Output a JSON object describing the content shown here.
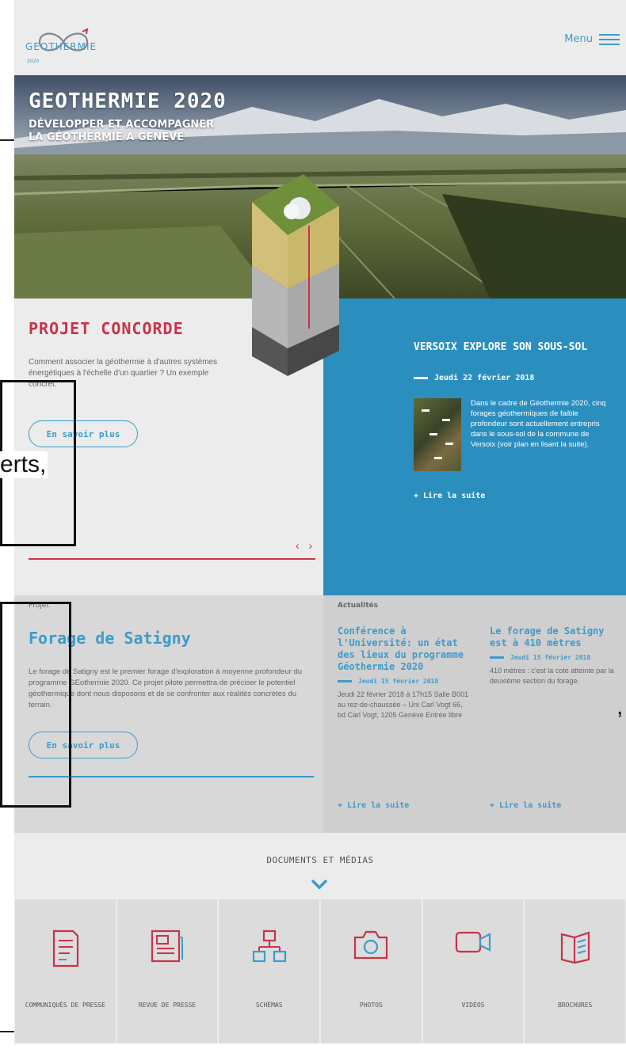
{
  "overlay": {
    "fragments": [
      "erts,",
      ","
    ]
  },
  "header": {
    "logo_name": "GEOTHERMIE",
    "logo_sub": "2020",
    "menu_label": "Menu"
  },
  "hero": {
    "title": "GEOTHERMIE 2020",
    "subtitle_line1": "DÉVELOPPER ET ACCOMPAGNER",
    "subtitle_line2": "LA GÉOTHERMIE À GENÈVE"
  },
  "concorde": {
    "title": "PROJET CONCORDE",
    "text": "Comment associer la géothermie à d'autres systèmes énergétiques à l'échelle d'un quartier ? Un exemple concret.",
    "button": "En savoir plus",
    "arrows": "‹ ›"
  },
  "versoix": {
    "title": "VERSOIX EXPLORE SON SOUS-SOL",
    "date": "Jeudi 22 février 2018",
    "text": "Dans le cadre de Géothermie 2020, cinq forages géothermiques de faible profondeur sont actuellement entrepris dans le sous-sol de la commune de Versoix (voir plan en lisant la suite).",
    "more": "+ Lire la suite"
  },
  "projet": {
    "label": "Projet",
    "title": "Forage de Satigny",
    "text": "Le forage de Satigny est le premier forage d'exploration à moyenne profondeur du programme GEothermie 2020. Ce projet pilote permettra de préciser le potentiel géothermique dont nous disposons et de se confronter aux réalités concrètes du terrain.",
    "button": "En savoir plus"
  },
  "actualites": {
    "label": "Actualités",
    "items": [
      {
        "title": "Conférence à l'Université: un état des lieux du programme Géothermie 2020",
        "date": "Jeudi 15 février 2018",
        "body": "Jeudi 22 février 2018 à 17h15 Salle B001 au rez-de-chaussée – Uni Carl Vogt 66, bd Carl Vogt, 1205 Genève Entrée libre",
        "more": "+ Lire la suite"
      },
      {
        "title": "Le forage de Satigny est à 410 mètres",
        "date": "Jeudi 15 février 2018",
        "body": "410 mètres : c'est la cote atteinte par la deuxième section du forage.",
        "more": "+ Lire la suite"
      }
    ]
  },
  "docs": {
    "title": "DOCUMENTS ET MÉDIAS",
    "tiles": [
      {
        "label": "COMMUNIQUÉS DE PRESSE",
        "icon": "document-icon"
      },
      {
        "label": "REVUE DE PRESSE",
        "icon": "newspaper-icon"
      },
      {
        "label": "SCHÉMAS",
        "icon": "diagram-icon"
      },
      {
        "label": "PHOTOS",
        "icon": "camera-icon"
      },
      {
        "label": "VIDÉOS",
        "icon": "video-camera-icon"
      },
      {
        "label": "BROCHURES",
        "icon": "brochure-icon"
      }
    ]
  },
  "colors": {
    "accent_blue": "#3b9ccc",
    "panel_blue": "#2a8fbf",
    "accent_red": "#c8334a"
  }
}
